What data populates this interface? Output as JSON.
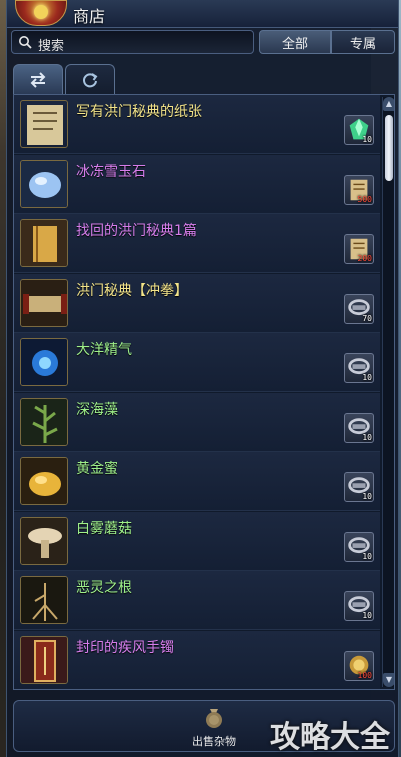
{
  "window": {
    "title": "商店"
  },
  "search": {
    "label": "搜索"
  },
  "filters": {
    "all": "全部",
    "exclusive": "专属"
  },
  "tabs": [
    {
      "icon": "swap-arrows-icon"
    },
    {
      "icon": "refresh-icon"
    }
  ],
  "items": [
    {
      "name": "写有洪门秘典的纸张",
      "color": "#f3e48a",
      "icon": "paper-scroll-icon",
      "price": "10",
      "price_icon": "green-gem-icon",
      "price_red": false
    },
    {
      "name": "冰冻雪玉石",
      "color": "#d57dea",
      "icon": "ice-jade-stone-icon",
      "price": "500",
      "price_icon": "book-currency-icon",
      "price_red": true
    },
    {
      "name": "找回的洪门秘典1篇",
      "color": "#d57dea",
      "icon": "secret-book-icon",
      "price": "200",
      "price_icon": "book-currency-icon",
      "price_red": true
    },
    {
      "name": "洪门秘典【冲拳】",
      "color": "#f3e48a",
      "icon": "open-scroll-icon",
      "price": "70",
      "price_icon": "coin-token-icon",
      "price_red": false
    },
    {
      "name": "大洋精气",
      "color": "#9ff08a",
      "icon": "ocean-essence-icon",
      "price": "10",
      "price_icon": "coin-token-icon",
      "price_red": false
    },
    {
      "name": "深海藻",
      "color": "#9ff08a",
      "icon": "seaweed-icon",
      "price": "10",
      "price_icon": "coin-token-icon",
      "price_red": false
    },
    {
      "name": "黄金蜜",
      "color": "#9ff08a",
      "icon": "golden-honey-icon",
      "price": "10",
      "price_icon": "coin-token-icon",
      "price_red": false
    },
    {
      "name": "白雾蘑菇",
      "color": "#9ff08a",
      "icon": "mushroom-icon",
      "price": "10",
      "price_icon": "coin-token-icon",
      "price_red": false
    },
    {
      "name": "恶灵之根",
      "color": "#9ff08a",
      "icon": "root-icon",
      "price": "10",
      "price_icon": "coin-token-icon",
      "price_red": false
    },
    {
      "name": "封印的疾风手镯",
      "color": "#d57dea",
      "icon": "sealed-bracelet-icon",
      "price": "100",
      "price_icon": "gold-medal-icon",
      "price_red": true
    }
  ],
  "bottom": {
    "sell_label": "出售杂物"
  },
  "watermark": {
    "text": "攻略大全"
  }
}
